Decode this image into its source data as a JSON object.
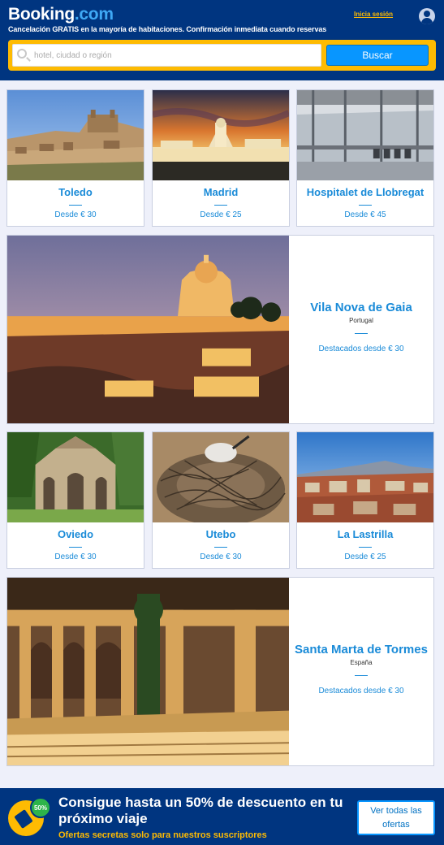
{
  "header": {
    "brand_main": "Booking",
    "brand_dot": ".com",
    "tagline": "Cancelación GRATIS en la mayoría de habitaciones. Confirmación inmediata cuando reservas",
    "signin_label": "Inicia sesión",
    "search": {
      "placeholder": "hotel, ciudad o región",
      "value": "",
      "button_label": "Buscar"
    }
  },
  "destinations_row1": [
    {
      "name": "Toledo",
      "price": "Desde € 30"
    },
    {
      "name": "Madrid",
      "price": "Desde € 25"
    },
    {
      "name": "Hospitalet de Llobregat",
      "price": "Desde € 45"
    }
  ],
  "featured1": {
    "name": "Vila Nova de Gaia",
    "country": "Portugal",
    "price": "Destacados desde € 30"
  },
  "destinations_row2": [
    {
      "name": "Oviedo",
      "price": "Desde € 30"
    },
    {
      "name": "Utebo",
      "price": "Desde € 30"
    },
    {
      "name": "La Lastrilla",
      "price": "Desde € 25"
    }
  ],
  "featured2": {
    "name": "Santa Marta de Tormes",
    "country": "España",
    "price": "Destacados desde € 30"
  },
  "promo": {
    "badge": "50%",
    "title": "Consigue hasta un 50% de descuento en tu próximo viaje",
    "subtitle": "Ofertas secretas solo para nuestros suscriptores",
    "button_label": "Ver todas las ofertas"
  },
  "colors": {
    "header_bg": "#003580",
    "accent_yellow": "#febb02",
    "link_blue": "#1a8bd8",
    "button_blue": "#0896ff"
  }
}
